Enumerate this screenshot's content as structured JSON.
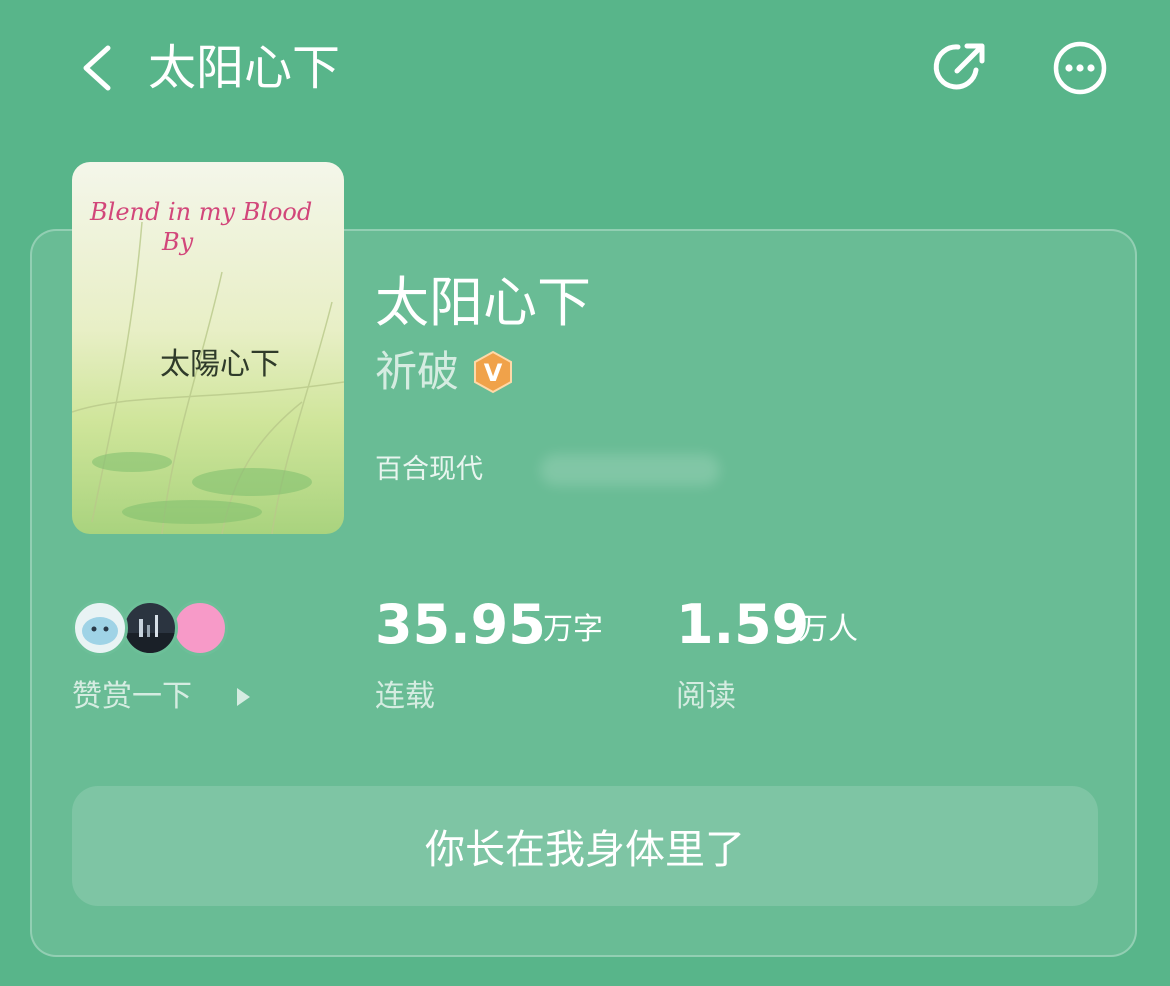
{
  "header": {
    "title": "太阳心下",
    "icons": {
      "back": "chevron-left-icon",
      "share": "share-icon",
      "more": "more-icon"
    }
  },
  "book": {
    "title": "太阳心下",
    "author": "祈破",
    "author_badge": "V",
    "category": "百合现代",
    "cover": {
      "text_en_line1": "Blend in my Blood",
      "text_en_line2": "By",
      "text_zh": "太陽心下"
    }
  },
  "reward": {
    "label": "赞赏一下"
  },
  "stats": {
    "words": {
      "value": "35.95",
      "unit": "万字",
      "label": "连载"
    },
    "readers": {
      "value": "1.59",
      "unit": "万人",
      "label": "阅读"
    }
  },
  "quote_button": {
    "label": "你长在我身体里了"
  },
  "colors": {
    "background": "#58b58a",
    "badge": "#f0a24a",
    "avatar_pink": "#f79ac8"
  }
}
